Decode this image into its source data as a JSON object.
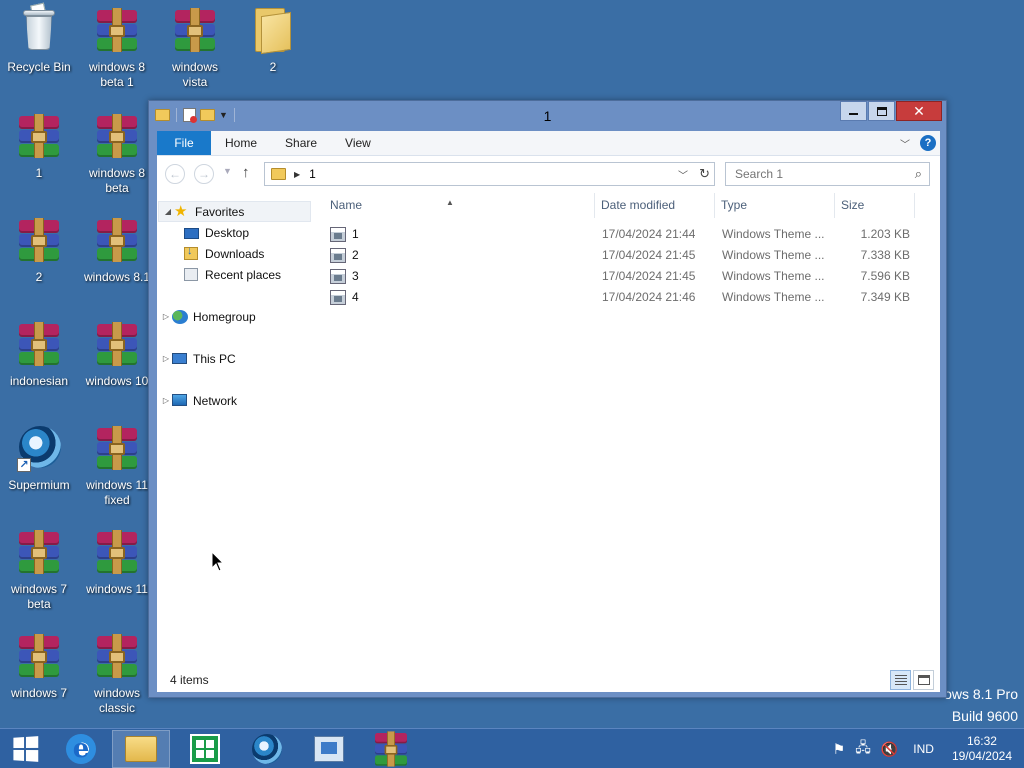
{
  "desktop": {
    "icons": [
      {
        "label": "Recycle Bin",
        "kind": "recycle-bin"
      },
      {
        "label": "windows 8 beta 1",
        "kind": "winrar"
      },
      {
        "label": "windows vista",
        "kind": "winrar"
      },
      {
        "label": "2",
        "kind": "folder"
      },
      {
        "label": "1",
        "kind": "winrar"
      },
      {
        "label": "windows 8 beta",
        "kind": "winrar"
      },
      {
        "label": "2",
        "kind": "winrar"
      },
      {
        "label": "windows 8.1",
        "kind": "winrar"
      },
      {
        "label": "indonesian",
        "kind": "winrar"
      },
      {
        "label": "windows 10",
        "kind": "winrar"
      },
      {
        "label": "Supermium",
        "kind": "browser-shortcut"
      },
      {
        "label": "windows 11 fixed",
        "kind": "winrar"
      },
      {
        "label": "windows 7 beta",
        "kind": "winrar"
      },
      {
        "label": "windows 11",
        "kind": "winrar"
      },
      {
        "label": "windows 7",
        "kind": "winrar"
      },
      {
        "label": "windows classic",
        "kind": "winrar"
      }
    ],
    "watermark": {
      "line1": "ows 8.1 Pro",
      "line2": "Build 9600"
    }
  },
  "explorer": {
    "title": "1",
    "tabs": {
      "file": "File",
      "home": "Home",
      "share": "Share",
      "view": "View"
    },
    "address": {
      "path": "1"
    },
    "search": {
      "placeholder": "Search 1"
    },
    "nav": {
      "favorites": "Favorites",
      "desktop": "Desktop",
      "downloads": "Downloads",
      "recent": "Recent places",
      "homegroup": "Homegroup",
      "thispc": "This PC",
      "network": "Network"
    },
    "columns": {
      "name": "Name",
      "date": "Date modified",
      "type": "Type",
      "size": "Size"
    },
    "files": [
      {
        "name": "1",
        "date": "17/04/2024 21:44",
        "type": "Windows Theme ...",
        "size": "1.203 KB"
      },
      {
        "name": "2",
        "date": "17/04/2024 21:45",
        "type": "Windows Theme ...",
        "size": "7.338 KB"
      },
      {
        "name": "3",
        "date": "17/04/2024 21:45",
        "type": "Windows Theme ...",
        "size": "7.596 KB"
      },
      {
        "name": "4",
        "date": "17/04/2024 21:46",
        "type": "Windows Theme ...",
        "size": "7.349 KB"
      }
    ],
    "status": {
      "count": "4 items"
    }
  },
  "taskbar": {
    "language": "IND",
    "time": "16:32",
    "date": "19/04/2024"
  },
  "colors": {
    "accent": "#1979ca",
    "desktop": "#3a6ea5",
    "taskbar": "#2f61a1"
  }
}
